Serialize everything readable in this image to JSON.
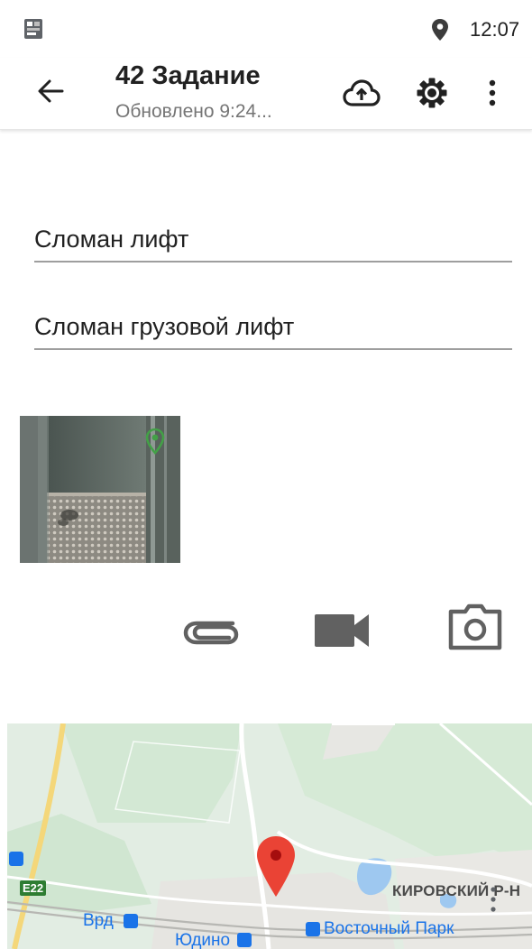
{
  "status_bar": {
    "time": "12:07",
    "left_icon": "app-notification-icon",
    "location_icon": "location-pin-icon"
  },
  "app_bar": {
    "title": "42 Задание",
    "subtitle": "Обновлено 9:24...",
    "back_icon": "arrow-back-icon",
    "actions": [
      "cloud-upload-icon",
      "settings-icon",
      "more-vert-icon"
    ]
  },
  "form": {
    "title_value": "Сломан лифт",
    "description_value": "Сломан грузовой лифт"
  },
  "attachments": {
    "photo": {
      "has_location": true,
      "marker_icon": "location-marker-icon"
    },
    "buttons": [
      "attach-file-icon",
      "videocam-icon",
      "camera-icon"
    ]
  },
  "map": {
    "road_shield": "E22",
    "district": "КИРОВСКИЙ Р-Н",
    "stations": [
      {
        "label": "Врд"
      },
      {
        "label": "Юдино"
      },
      {
        "label": "Восточный Парк"
      }
    ],
    "marker_color": "#ea4335"
  },
  "colors": {
    "accent_marker": "#43a047",
    "map_label": "#1a73e8",
    "text_primary": "#212121",
    "text_secondary": "#757575"
  }
}
